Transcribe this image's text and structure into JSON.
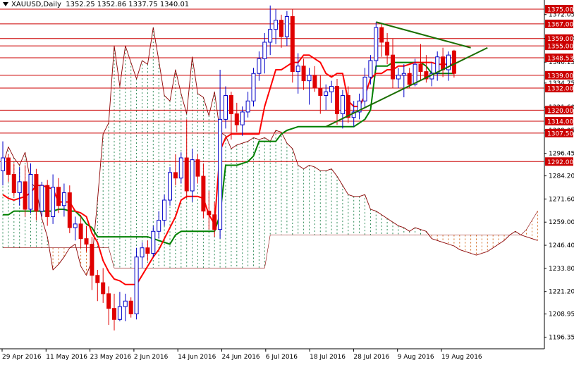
{
  "header": {
    "symbol": "XAUUSD,Daily",
    "ohlc": "1352.25 1352.86 1337.75 1340.01"
  },
  "colors": {
    "background": "#ffffff",
    "frame": "#000000",
    "bull_body": "#ffffff",
    "bull_outline": "#0000c8",
    "bear_body": "#e00000",
    "tenkan": "#ff0000",
    "kijun": "#008000",
    "span_a": "#8b0000",
    "cloud_bull": "#2e8b57",
    "cloud_bear": "#d2691e",
    "level_line": "#cc0000",
    "label_bg": "#cc0000",
    "label_text": "#ffffff",
    "triangle": "#1a6e00"
  },
  "chart_data": {
    "type": "candlestick",
    "title": "XAUUSD,Daily",
    "ylim": [
      1190,
      1380
    ],
    "y_ticks": [
      "1372.05",
      "1359.00",
      "1346.15",
      "1334.75",
      "1321.60",
      "1309.05",
      "1296.45",
      "1284.20",
      "1271.60",
      "1259.00",
      "1246.40",
      "1233.80",
      "1221.20",
      "1208.95",
      "1196.35"
    ],
    "x_ticks": [
      "29 Apr 2016",
      "11 May 2016",
      "23 May 2016",
      "2 Jun 2016",
      "14 Jun 2016",
      "24 Jun 2016",
      "6 Jul 2016",
      "18 Jul 2016",
      "28 Jul 2016",
      "9 Aug 2016",
      "19 Aug 2016"
    ],
    "horizontal_levels": [
      "1375.00",
      "1367.00",
      "1359.00",
      "1355.00",
      "1348.53",
      "1339.00",
      "1332.00",
      "1320.00",
      "1314.00",
      "1307.50",
      "1292.00"
    ],
    "candles": [
      {
        "o": 1287,
        "h": 1303,
        "l": 1279,
        "c": 1294
      },
      {
        "o": 1294,
        "h": 1296,
        "l": 1281,
        "c": 1285
      },
      {
        "o": 1285,
        "h": 1291,
        "l": 1273,
        "c": 1275
      },
      {
        "o": 1275,
        "h": 1289,
        "l": 1268,
        "c": 1281
      },
      {
        "o": 1281,
        "h": 1290,
        "l": 1262,
        "c": 1266
      },
      {
        "o": 1266,
        "h": 1291,
        "l": 1264,
        "c": 1285
      },
      {
        "o": 1285,
        "h": 1288,
        "l": 1260,
        "c": 1265
      },
      {
        "o": 1265,
        "h": 1281,
        "l": 1262,
        "c": 1279
      },
      {
        "o": 1279,
        "h": 1282,
        "l": 1257,
        "c": 1262
      },
      {
        "o": 1262,
        "h": 1285,
        "l": 1258,
        "c": 1278
      },
      {
        "o": 1278,
        "h": 1283,
        "l": 1264,
        "c": 1268
      },
      {
        "o": 1268,
        "h": 1280,
        "l": 1262,
        "c": 1275
      },
      {
        "o": 1275,
        "h": 1279,
        "l": 1253,
        "c": 1256
      },
      {
        "o": 1256,
        "h": 1262,
        "l": 1249,
        "c": 1258
      },
      {
        "o": 1258,
        "h": 1263,
        "l": 1245,
        "c": 1250
      },
      {
        "o": 1250,
        "h": 1257,
        "l": 1243,
        "c": 1247
      },
      {
        "o": 1247,
        "h": 1251,
        "l": 1222,
        "c": 1230
      },
      {
        "o": 1230,
        "h": 1233,
        "l": 1216,
        "c": 1226
      },
      {
        "o": 1226,
        "h": 1234,
        "l": 1215,
        "c": 1220
      },
      {
        "o": 1220,
        "h": 1224,
        "l": 1203,
        "c": 1212
      },
      {
        "o": 1212,
        "h": 1220,
        "l": 1200,
        "c": 1206
      },
      {
        "o": 1206,
        "h": 1221,
        "l": 1205,
        "c": 1213
      },
      {
        "o": 1213,
        "h": 1220,
        "l": 1205,
        "c": 1216
      },
      {
        "o": 1216,
        "h": 1218,
        "l": 1207,
        "c": 1209
      },
      {
        "o": 1209,
        "h": 1245,
        "l": 1206,
        "c": 1240
      },
      {
        "o": 1240,
        "h": 1248,
        "l": 1234,
        "c": 1245
      },
      {
        "o": 1245,
        "h": 1249,
        "l": 1238,
        "c": 1242
      },
      {
        "o": 1242,
        "h": 1257,
        "l": 1240,
        "c": 1254
      },
      {
        "o": 1254,
        "h": 1265,
        "l": 1250,
        "c": 1260
      },
      {
        "o": 1260,
        "h": 1274,
        "l": 1257,
        "c": 1271
      },
      {
        "o": 1271,
        "h": 1289,
        "l": 1268,
        "c": 1286
      },
      {
        "o": 1286,
        "h": 1296,
        "l": 1279,
        "c": 1283
      },
      {
        "o": 1283,
        "h": 1297,
        "l": 1280,
        "c": 1294
      },
      {
        "o": 1294,
        "h": 1315,
        "l": 1272,
        "c": 1276
      },
      {
        "o": 1276,
        "h": 1299,
        "l": 1270,
        "c": 1293
      },
      {
        "o": 1293,
        "h": 1296,
        "l": 1280,
        "c": 1284
      },
      {
        "o": 1284,
        "h": 1291,
        "l": 1261,
        "c": 1265
      },
      {
        "o": 1265,
        "h": 1276,
        "l": 1255,
        "c": 1263
      },
      {
        "o": 1263,
        "h": 1270,
        "l": 1251,
        "c": 1255
      },
      {
        "o": 1255,
        "h": 1342,
        "l": 1250,
        "c": 1315
      },
      {
        "o": 1315,
        "h": 1333,
        "l": 1310,
        "c": 1328
      },
      {
        "o": 1328,
        "h": 1330,
        "l": 1304,
        "c": 1318
      },
      {
        "o": 1318,
        "h": 1324,
        "l": 1308,
        "c": 1312
      },
      {
        "o": 1312,
        "h": 1322,
        "l": 1306,
        "c": 1319
      },
      {
        "o": 1319,
        "h": 1330,
        "l": 1316,
        "c": 1325
      },
      {
        "o": 1325,
        "h": 1343,
        "l": 1322,
        "c": 1340
      },
      {
        "o": 1340,
        "h": 1352,
        "l": 1336,
        "c": 1348
      },
      {
        "o": 1348,
        "h": 1362,
        "l": 1340,
        "c": 1357
      },
      {
        "o": 1357,
        "h": 1377,
        "l": 1350,
        "c": 1364
      },
      {
        "o": 1364,
        "h": 1375,
        "l": 1356,
        "c": 1369
      },
      {
        "o": 1369,
        "h": 1372,
        "l": 1354,
        "c": 1360
      },
      {
        "o": 1360,
        "h": 1374,
        "l": 1355,
        "c": 1371
      },
      {
        "o": 1371,
        "h": 1375,
        "l": 1335,
        "c": 1341
      },
      {
        "o": 1341,
        "h": 1351,
        "l": 1329,
        "c": 1344
      },
      {
        "o": 1344,
        "h": 1348,
        "l": 1331,
        "c": 1336
      },
      {
        "o": 1336,
        "h": 1343,
        "l": 1323,
        "c": 1339
      },
      {
        "o": 1339,
        "h": 1344,
        "l": 1330,
        "c": 1332
      },
      {
        "o": 1332,
        "h": 1339,
        "l": 1318,
        "c": 1328
      },
      {
        "o": 1328,
        "h": 1334,
        "l": 1320,
        "c": 1330
      },
      {
        "o": 1330,
        "h": 1336,
        "l": 1324,
        "c": 1333
      },
      {
        "o": 1333,
        "h": 1337,
        "l": 1312,
        "c": 1318
      },
      {
        "o": 1318,
        "h": 1331,
        "l": 1310,
        "c": 1328
      },
      {
        "o": 1328,
        "h": 1333,
        "l": 1313,
        "c": 1316
      },
      {
        "o": 1316,
        "h": 1325,
        "l": 1311,
        "c": 1319
      },
      {
        "o": 1319,
        "h": 1329,
        "l": 1315,
        "c": 1325
      },
      {
        "o": 1325,
        "h": 1343,
        "l": 1321,
        "c": 1338
      },
      {
        "o": 1338,
        "h": 1350,
        "l": 1334,
        "c": 1347
      },
      {
        "o": 1347,
        "h": 1368,
        "l": 1342,
        "c": 1365
      },
      {
        "o": 1365,
        "h": 1367,
        "l": 1349,
        "c": 1357
      },
      {
        "o": 1357,
        "h": 1362,
        "l": 1345,
        "c": 1350
      },
      {
        "o": 1350,
        "h": 1359,
        "l": 1332,
        "c": 1337
      },
      {
        "o": 1337,
        "h": 1343,
        "l": 1332,
        "c": 1339
      },
      {
        "o": 1339,
        "h": 1345,
        "l": 1327,
        "c": 1340
      },
      {
        "o": 1340,
        "h": 1343,
        "l": 1332,
        "c": 1334
      },
      {
        "o": 1334,
        "h": 1348,
        "l": 1333,
        "c": 1345
      },
      {
        "o": 1345,
        "h": 1356,
        "l": 1336,
        "c": 1341
      },
      {
        "o": 1341,
        "h": 1350,
        "l": 1335,
        "c": 1337
      },
      {
        "o": 1337,
        "h": 1346,
        "l": 1333,
        "c": 1340
      },
      {
        "o": 1340,
        "h": 1352,
        "l": 1336,
        "c": 1349
      },
      {
        "o": 1349,
        "h": 1354,
        "l": 1338,
        "c": 1342
      },
      {
        "o": 1342,
        "h": 1352,
        "l": 1336,
        "c": 1350
      },
      {
        "o": 1352.25,
        "h": 1352.86,
        "l": 1337.75,
        "c": 1340.01
      }
    ],
    "tenkan": [
      1274,
      1272,
      1271,
      1272,
      1273,
      1275,
      1279,
      1279,
      1278,
      1277,
      1270,
      1270,
      1270,
      1265,
      1264,
      1262,
      1253,
      1248,
      1238,
      1232,
      1228,
      1227,
      1225,
      1225,
      1225,
      1230,
      1235,
      1240,
      1244,
      1250,
      1256,
      1262,
      1271,
      1273,
      1273,
      1273,
      1272,
      1263,
      1258,
      1298,
      1305,
      1307,
      1307,
      1307,
      1307,
      1307,
      1307,
      1322,
      1332,
      1342,
      1342,
      1344,
      1346,
      1346,
      1350,
      1350,
      1348,
      1346,
      1340,
      1338,
      1340,
      1340,
      1325,
      1322,
      1322,
      1328,
      1337,
      1340,
      1340,
      1342,
      1342,
      1344,
      1344,
      1345,
      1346,
      1346,
      1346,
      1346,
      1345,
      1345,
      1345,
      1345
    ],
    "kijun": [
      1263,
      1263,
      1265,
      1265,
      1265,
      1265,
      1265,
      1265,
      1265,
      1265,
      1266,
      1266,
      1265,
      1265,
      1262,
      1258,
      1256,
      1251,
      1251,
      1251,
      1251,
      1251,
      1251,
      1251,
      1251,
      1251,
      1251,
      1250,
      1249,
      1248,
      1247,
      1252,
      1254,
      1254,
      1254,
      1254,
      1254,
      1254,
      1254,
      1263,
      1290,
      1290,
      1290,
      1291,
      1292,
      1295,
      1303,
      1303,
      1303,
      1303,
      1307,
      1309,
      1310,
      1311,
      1311,
      1311,
      1311,
      1311,
      1311,
      1311,
      1311,
      1311,
      1311,
      1311,
      1313,
      1315,
      1320,
      1344,
      1344,
      1344,
      1346,
      1346,
      1346,
      1346,
      1346,
      1346,
      1344,
      1340,
      1340,
      1340,
      1340,
      1340
    ],
    "span_a": [
      1290,
      1300,
      1294,
      1290,
      1297,
      1281,
      1277,
      1261,
      1251,
      1233,
      1236,
      1240,
      1245,
      1247,
      1235,
      1230,
      1238,
      1271,
      1307,
      1313,
      1355,
      1333,
      1355,
      1346,
      1337,
      1347,
      1345,
      1365,
      1347,
      1328,
      1325,
      1342,
      1329,
      1318,
      1349,
      1329,
      1327,
      1317,
      1330,
      1308,
      1306,
      1299,
      1301,
      1302,
      1303,
      1305,
      1304,
      1305,
      1303,
      1309,
      1308,
      1302,
      1299,
      1290,
      1288,
      1290,
      1289,
      1287,
      1287,
      1288,
      1284,
      1279,
      1274,
      1273,
      1273,
      1274,
      1266,
      1265,
      1263,
      1261,
      1259,
      1257,
      1256,
      1254,
      1256,
      1255,
      1254,
      1250,
      1249,
      1248,
      1247,
      1246,
      1244,
      1243,
      1242,
      1241,
      1242,
      1243,
      1245,
      1247,
      1249,
      1252,
      1254,
      1252,
      1251,
      1250,
      1249,
      1248,
      1250,
      1253,
      1258,
      1262,
      1266,
      1270,
      1277,
      1284,
      1293,
      1296,
      1299,
      1300,
      1299,
      1300,
      1299,
      1300,
      1300,
      1300,
      1300,
      1299,
      1300,
      1304,
      1315,
      1320,
      1328,
      1330,
      1332,
      1332,
      1332,
      1331,
      1329,
      1327,
      1325,
      1322,
      1320,
      1319,
      1320,
      1318,
      1318,
      1319,
      1320,
      1329,
      1336,
      1338,
      1340,
      1340,
      1340,
      1340
    ],
    "span_b": [
      1245,
      1245,
      1245,
      1245,
      1245,
      1245,
      1245,
      1245,
      1245,
      1245,
      1245,
      1245,
      1245,
      1245,
      1245,
      1245,
      1245,
      1245,
      1245,
      1245,
      1234,
      1234,
      1234,
      1234,
      1234,
      1234,
      1234,
      1234,
      1234,
      1234,
      1234,
      1234,
      1234,
      1234,
      1234,
      1234,
      1234,
      1234,
      1234,
      1234,
      1234,
      1234,
      1234,
      1234,
      1234,
      1234,
      1234,
      1234,
      1252,
      1252,
      1252,
      1252,
      1252,
      1252,
      1252,
      1252,
      1252,
      1252,
      1252,
      1252,
      1252,
      1252,
      1252,
      1252,
      1252,
      1252,
      1252,
      1252,
      1252,
      1252,
      1252,
      1252,
      1252,
      1252,
      1252,
      1252,
      1252,
      1252,
      1252,
      1252,
      1252,
      1252,
      1252,
      1252,
      1252,
      1252,
      1252,
      1252,
      1252,
      1252,
      1252,
      1252,
      1252,
      1252,
      1255,
      1260,
      1265,
      1270,
      1275,
      1282,
      1282,
      1282,
      1282,
      1282,
      1282,
      1282,
      1282,
      1282,
      1282,
      1282,
      1282,
      1282,
      1282,
      1282,
      1290,
      1290,
      1290,
      1290,
      1290,
      1290,
      1290,
      1290,
      1290,
      1290,
      1290,
      1290,
      1290,
      1290,
      1290,
      1290,
      1290,
      1290,
      1290,
      1290,
      1290,
      1290,
      1290,
      1290,
      1290,
      1290,
      1290,
      1290,
      1290,
      1290,
      1290
    ],
    "trendlines": [
      {
        "from": {
          "bar": 67,
          "y": 1368
        },
        "to": {
          "bar": 84,
          "y": 1354
        }
      },
      {
        "from": {
          "bar": 58,
          "y": 1311
        },
        "to": {
          "bar": 87,
          "y": 1354
        }
      }
    ],
    "grid": false
  }
}
